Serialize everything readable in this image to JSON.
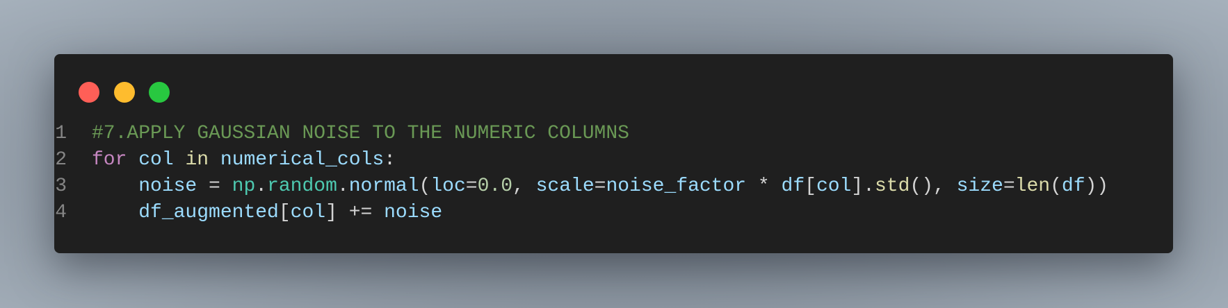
{
  "window": {
    "controls": [
      {
        "name": "close",
        "color": "#ff5f57"
      },
      {
        "name": "minimize",
        "color": "#febc2e"
      },
      {
        "name": "maximize",
        "color": "#28c840"
      }
    ]
  },
  "code": {
    "lines": [
      {
        "number": "1",
        "tokens": [
          [
            "#7.APPLY GAUSSIAN NOISE TO THE NUMERIC COLUMNS",
            "comment"
          ]
        ]
      },
      {
        "number": "2",
        "tokens": [
          [
            "for",
            "keyword"
          ],
          [
            " ",
            "punc"
          ],
          [
            "col",
            "var"
          ],
          [
            " ",
            "punc"
          ],
          [
            "in",
            "yellow"
          ],
          [
            " ",
            "punc"
          ],
          [
            "numerical_cols",
            "var"
          ],
          [
            ":",
            "punc"
          ]
        ]
      },
      {
        "number": "3",
        "tokens": [
          [
            "    ",
            "punc"
          ],
          [
            "noise",
            "var"
          ],
          [
            " = ",
            "op"
          ],
          [
            "np",
            "module"
          ],
          [
            ".",
            "punc"
          ],
          [
            "random",
            "module"
          ],
          [
            ".",
            "punc"
          ],
          [
            "normal",
            "var"
          ],
          [
            "(",
            "punc"
          ],
          [
            "loc",
            "var"
          ],
          [
            "=",
            "op"
          ],
          [
            "0.0",
            "num"
          ],
          [
            ", ",
            "punc"
          ],
          [
            "scale",
            "var"
          ],
          [
            "=",
            "op"
          ],
          [
            "noise_factor",
            "var"
          ],
          [
            " * ",
            "op"
          ],
          [
            "df",
            "var"
          ],
          [
            "[",
            "punc"
          ],
          [
            "col",
            "var"
          ],
          [
            "]",
            "punc"
          ],
          [
            ".",
            "punc"
          ],
          [
            "std",
            "yellow"
          ],
          [
            "()",
            "punc"
          ],
          [
            ", ",
            "punc"
          ],
          [
            "size",
            "var"
          ],
          [
            "=",
            "op"
          ],
          [
            "len",
            "yellow"
          ],
          [
            "(",
            "punc"
          ],
          [
            "df",
            "var"
          ],
          [
            "))",
            "punc"
          ]
        ]
      },
      {
        "number": "4",
        "tokens": [
          [
            "    ",
            "punc"
          ],
          [
            "df_augmented",
            "var"
          ],
          [
            "[",
            "punc"
          ],
          [
            "col",
            "var"
          ],
          [
            "]",
            "punc"
          ],
          [
            " += ",
            "op"
          ],
          [
            "noise",
            "var"
          ]
        ]
      }
    ]
  }
}
